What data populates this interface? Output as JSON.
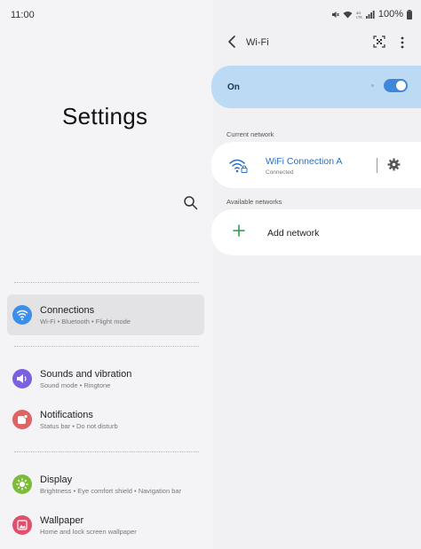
{
  "status_bar": {
    "time": "11:00",
    "battery": "100%",
    "icons": [
      "mute-icon",
      "wifi-status-icon",
      "volte-icon",
      "signal-icon",
      "battery-icon"
    ]
  },
  "left": {
    "title": "Settings",
    "menu": [
      {
        "title": "Connections",
        "subtitle": "Wi-Fi  •  Bluetooth  •  Flight mode",
        "icon": "wifi-icon",
        "color": "#3b8eea",
        "selected": true
      },
      {
        "title": "Sounds and vibration",
        "subtitle": "Sound mode  •  Ringtone",
        "icon": "volume-icon",
        "color": "#7b61e0"
      },
      {
        "title": "Notifications",
        "subtitle": "Status bar  •  Do not disturb",
        "icon": "notification-icon",
        "color": "#e06262"
      },
      {
        "title": "Display",
        "subtitle": "Brightness  •  Eye comfort shield  •  Navigation bar",
        "icon": "brightness-icon",
        "color": "#7dbb3a"
      },
      {
        "title": "Wallpaper",
        "subtitle": "Home and lock screen wallpaper",
        "icon": "wallpaper-icon",
        "color": "#e04f6d"
      }
    ]
  },
  "right": {
    "title": "Wi-Fi",
    "on_label": "On",
    "toggle_on": true,
    "current_network_label": "Current network",
    "current_network": {
      "name": "WiFi Connection A",
      "status": "Connected"
    },
    "available_networks_label": "Available networks",
    "add_network_label": "Add network"
  },
  "colors": {
    "accent": "#3f87d9",
    "on_card": "#bcdaf3",
    "network_name": "#2a6fc0",
    "add_plus": "#2e9a48"
  }
}
